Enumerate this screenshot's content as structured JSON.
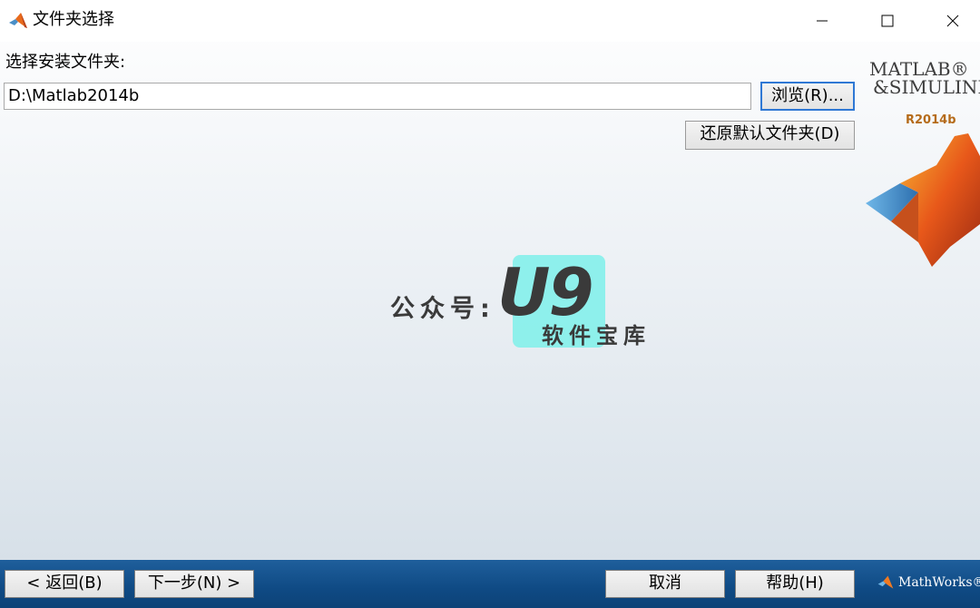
{
  "window": {
    "title": "文件夹选择",
    "controls": {
      "minimize": "—",
      "maximize": "☐",
      "close": "✕"
    }
  },
  "folder": {
    "label": "选择安装文件夹:",
    "path": "D:\\Matlab2014b",
    "browse_label": "浏览(R)...",
    "restore_label": "还原默认文件夹(D)"
  },
  "branding": {
    "product_line1": "MATLAB®",
    "product_line2": "&SIMULINK®",
    "release": "R2014b",
    "company": "MathWorks®"
  },
  "watermark": {
    "prefix": "公众号:",
    "brand": "U9",
    "subtitle": "软件宝库"
  },
  "footer": {
    "back_label": "< 返回(B)",
    "next_label": "下一步(N) >",
    "cancel_label": "取消",
    "help_label": "帮助(H)"
  },
  "colors": {
    "footer_blue": "#0f4a84",
    "focus_border": "#2f78d4",
    "watermark_box": "#7ef0ea"
  }
}
